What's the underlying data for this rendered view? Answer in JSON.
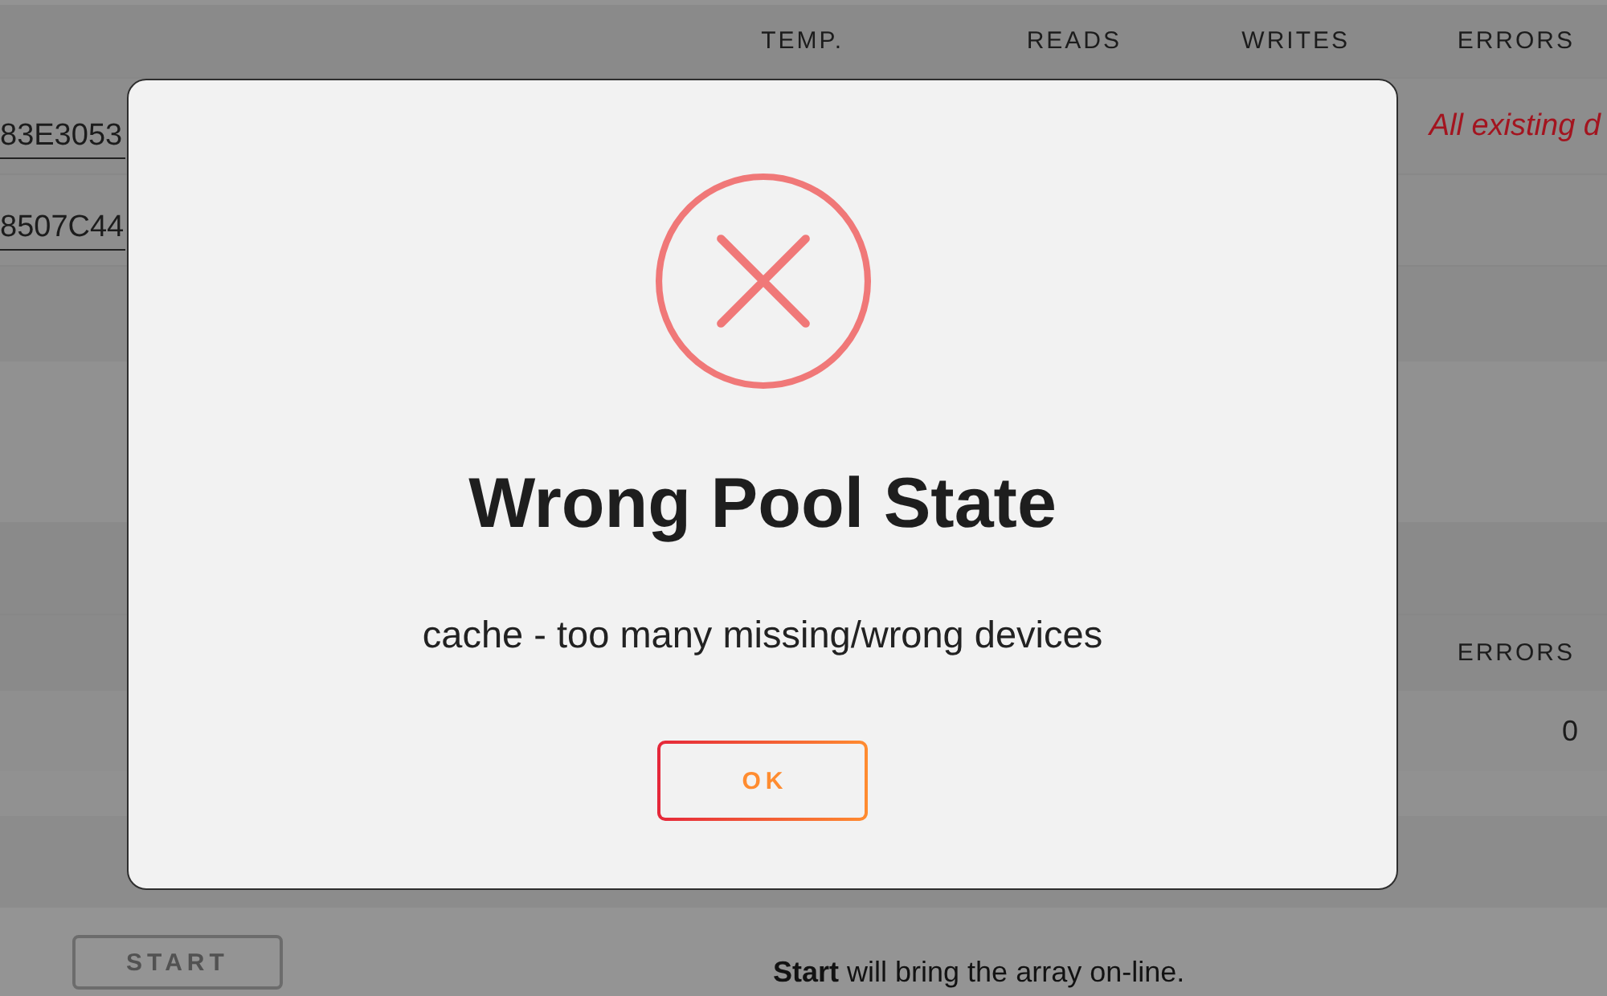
{
  "disk_table": {
    "columns": [
      "TEMP.",
      "READS",
      "WRITES",
      "ERRORS"
    ],
    "rows": [
      {
        "device": "83E3053",
        "note": "All existing d"
      },
      {
        "device": "8507C44"
      }
    ]
  },
  "pool_table": {
    "columns": [
      "ERRORS"
    ],
    "rows": [
      {
        "errors": "0"
      }
    ]
  },
  "array_operation": {
    "start_button": {
      "label": "START",
      "disabled": true
    },
    "note": "**Start** will bring the array on-line."
  },
  "dialog": {
    "kind": "error",
    "title": "Wrong Pool State",
    "message": "cache - too many missing/wrong devices",
    "button": "OK"
  }
}
